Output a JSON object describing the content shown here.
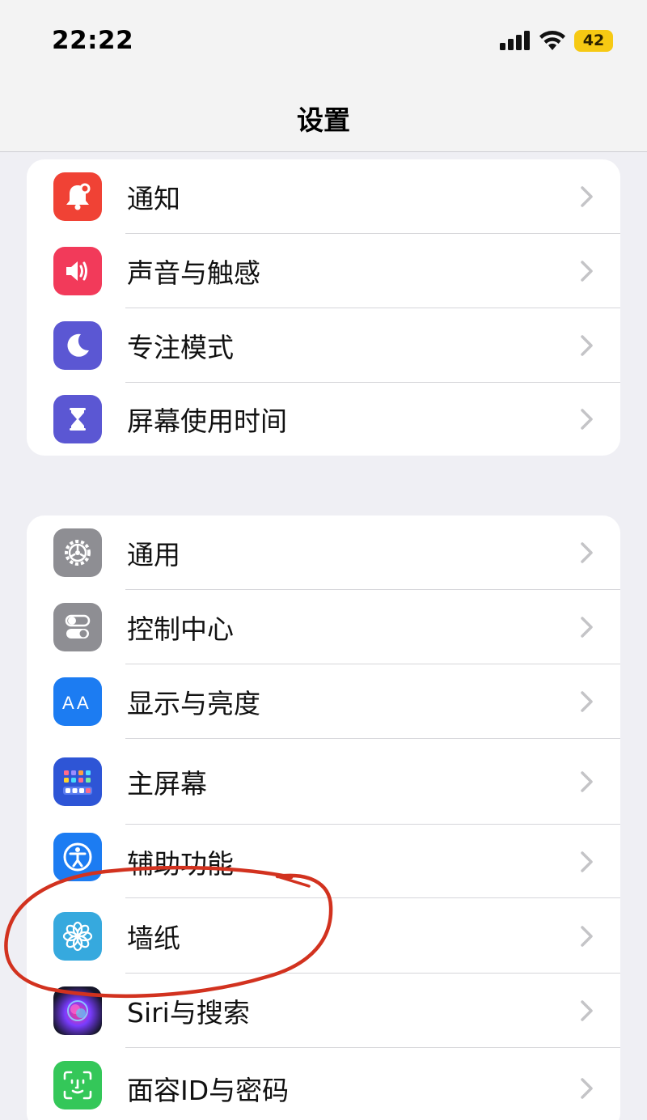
{
  "status_bar": {
    "time": "22:22",
    "battery_level": "42"
  },
  "page": {
    "title": "设置"
  },
  "groups": [
    {
      "items": [
        {
          "label": "通知",
          "icon": "bell-icon",
          "color": "#f04235"
        },
        {
          "label": "声音与触感",
          "icon": "speaker-icon",
          "color": "#f23a5a"
        },
        {
          "label": "专注模式",
          "icon": "moon-icon",
          "color": "#5b57d3"
        },
        {
          "label": "屏幕使用时间",
          "icon": "hourglass-icon",
          "color": "#5b57d3"
        }
      ]
    },
    {
      "items": [
        {
          "label": "通用",
          "icon": "gear-icon",
          "color": "#8e8e93"
        },
        {
          "label": "控制中心",
          "icon": "toggles-icon",
          "color": "#8e8e93"
        },
        {
          "label": "显示与亮度",
          "icon": "text-size-icon",
          "color": "#1c7cf2"
        },
        {
          "label": "主屏幕",
          "icon": "home-screen-icon",
          "color": "#2e55d6"
        },
        {
          "label": "辅助功能",
          "icon": "accessibility-icon",
          "color": "#1c7cf2"
        },
        {
          "label": "墙纸",
          "icon": "flower-icon",
          "color": "#36a9de"
        },
        {
          "label": "Siri与搜索",
          "icon": "siri-icon",
          "color": "#1a1a2e"
        },
        {
          "label": "面容ID与密码",
          "icon": "face-id-icon",
          "color": "#34c759"
        }
      ]
    }
  ],
  "colors": {
    "accent_annotation": "#d2321f",
    "chevron": "#c4c4c7"
  }
}
